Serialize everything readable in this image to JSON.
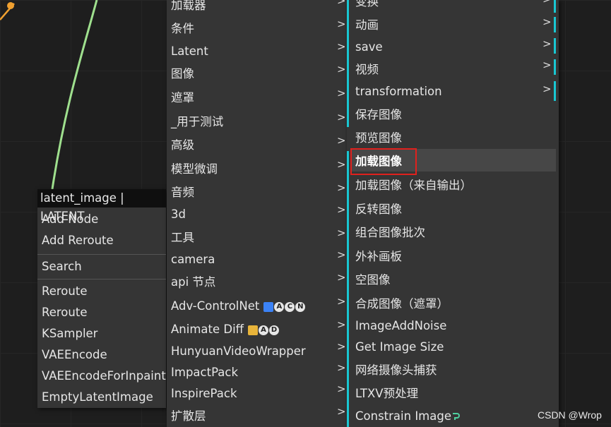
{
  "context_menu": {
    "header": "latent_image | LATENT",
    "items": [
      "Add Node",
      "Add Reroute",
      "Search",
      "Reroute",
      "Reroute",
      "KSampler",
      "VAEEncode",
      "VAEEncodeForInpaint",
      "EmptyLatentImage"
    ]
  },
  "category_menu": {
    "items": [
      {
        "label": "加载器"
      },
      {
        "label": "条件"
      },
      {
        "label": "Latent"
      },
      {
        "label": "图像"
      },
      {
        "label": "遮罩"
      },
      {
        "label": "_用于测试"
      },
      {
        "label": "高级"
      },
      {
        "label": "模型微调"
      },
      {
        "label": "音频"
      },
      {
        "label": "3d"
      },
      {
        "label": "工具"
      },
      {
        "label": "camera"
      },
      {
        "label": "api 节点"
      },
      {
        "label": "Adv-ControlNet",
        "badges": [
          "A",
          "C",
          "N"
        ]
      },
      {
        "label": "Animate Diff",
        "badges": [
          "A",
          "D"
        ]
      },
      {
        "label": "HunyuanVideoWrapper"
      },
      {
        "label": "ImpactPack"
      },
      {
        "label": "InspirePack"
      },
      {
        "label": "扩散层"
      }
    ],
    "arrow": ">"
  },
  "image_submenu": {
    "groups": [
      "变换",
      "动画",
      "save",
      "视频",
      "transformation"
    ],
    "nodes": [
      "保存图像",
      "预览图像",
      "加载图像",
      "加载图像（来自输出）",
      "反转图像",
      "组合图像批次",
      "外补画板",
      "空图像",
      "合成图像（遮罩）",
      "ImageAddNoise",
      "Get Image Size",
      "网络摄像头捕获",
      "LTXV预处理",
      "Constrain Image"
    ],
    "highlighted": "加载图像"
  },
  "watermark": "CSDN @Wrop",
  "colors": {
    "accent_bar": "#19c7d2",
    "highlight_box": "#e0211d",
    "wire_green": "#9fe08e",
    "wire_orange": "#f0a030"
  }
}
